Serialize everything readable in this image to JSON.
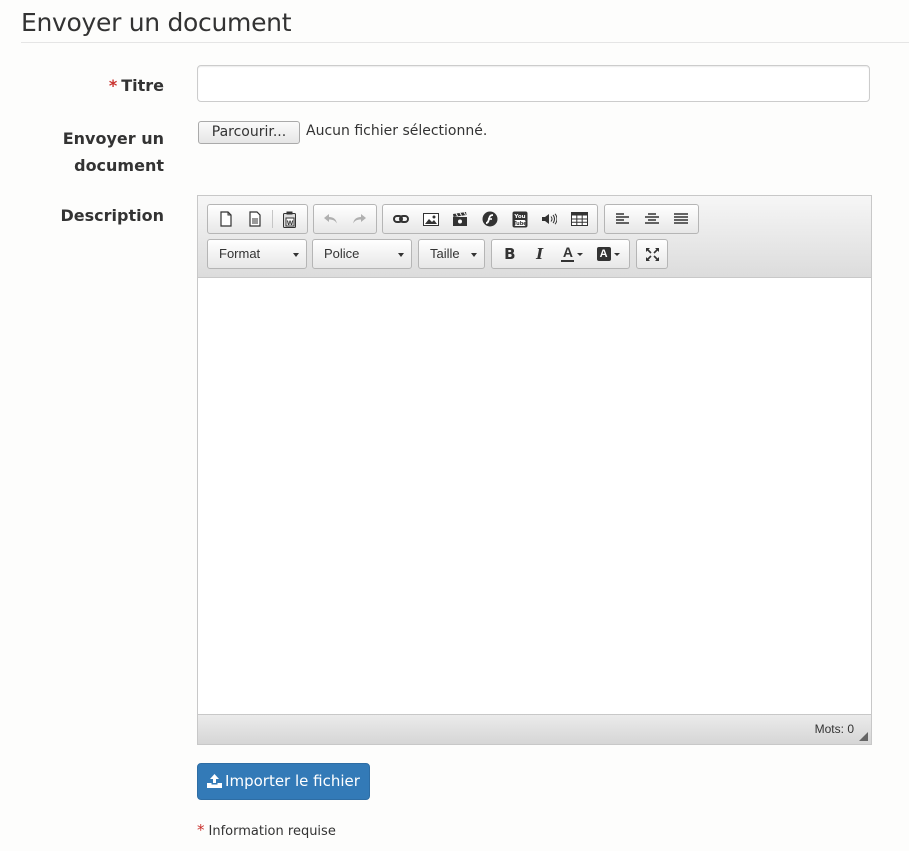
{
  "page": {
    "title": "Envoyer un document"
  },
  "form": {
    "title_label": "Titre",
    "title_required_marker": "*",
    "title_value": "",
    "upload_label": "Envoyer un document",
    "browse_button": "Parcourir...",
    "file_status": "Aucun fichier sélectionné.",
    "description_label": "Description",
    "submit_button": "Importer le fichier",
    "required_marker": "*",
    "required_note": "Information requise"
  },
  "editor": {
    "toolbar_row1": [
      {
        "name": "new-page-icon",
        "enabled": true
      },
      {
        "name": "preview-icon",
        "enabled": true
      },
      {
        "name": "paste-word-icon",
        "enabled": true
      },
      {
        "name": "undo-icon",
        "enabled": false
      },
      {
        "name": "redo-icon",
        "enabled": false
      },
      {
        "name": "link-icon",
        "enabled": true
      },
      {
        "name": "image-icon",
        "enabled": true
      },
      {
        "name": "video-icon",
        "enabled": true
      },
      {
        "name": "flash-icon",
        "enabled": true
      },
      {
        "name": "youtube-icon",
        "enabled": true
      },
      {
        "name": "audio-icon",
        "enabled": true
      },
      {
        "name": "table-icon",
        "enabled": true
      },
      {
        "name": "align-left-icon",
        "enabled": true
      },
      {
        "name": "align-center-icon",
        "enabled": true
      },
      {
        "name": "align-justify-icon",
        "enabled": true
      }
    ],
    "format_combo": "Format",
    "font_combo": "Police",
    "size_combo": "Taille",
    "bold_glyph": "B",
    "italic_glyph": "I",
    "text_color_glyph": "A",
    "bg_color_glyph": "A",
    "word_count": "Mots: 0"
  },
  "colors": {
    "primary": "#337ab7",
    "required": "#c9302c"
  }
}
